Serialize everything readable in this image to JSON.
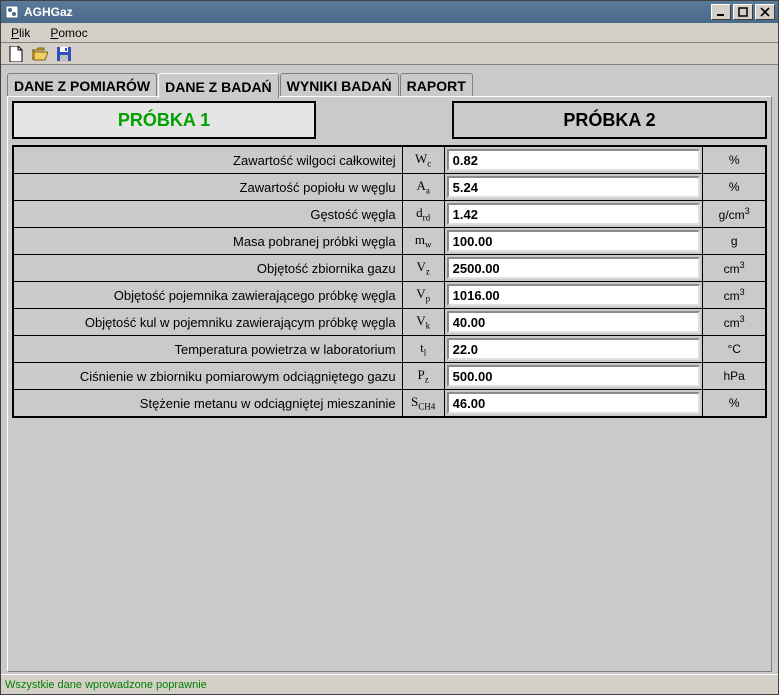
{
  "title": "AGHGaz",
  "menu": {
    "file": "Plik",
    "help": "Pomoc"
  },
  "tabs": {
    "t1": "DANE Z POMIARÓW",
    "t2": "DANE Z BADAŃ",
    "t3": "WYNIKI BADAŃ",
    "t4": "RAPORT"
  },
  "samples": {
    "s1": "PRÓBKA 1",
    "s2": "PRÓBKA 2"
  },
  "rows": [
    {
      "label": "Zawartość wilgoci całkowitej",
      "sym": "W<sub>c</sub>",
      "value": "0.82",
      "unit": "%"
    },
    {
      "label": "Zawartość popiołu w węglu",
      "sym": "A<sub>a</sub>",
      "value": "5.24",
      "unit": "%"
    },
    {
      "label": "Gęstość węgla",
      "sym": "d<sub>rd</sub>",
      "value": "1.42",
      "unit": "g/cm<sup>3</sup>"
    },
    {
      "label": "Masa pobranej próbki węgla",
      "sym": "m<sub>w</sub>",
      "value": "100.00",
      "unit": "g"
    },
    {
      "label": "Objętość zbiornika gazu",
      "sym": "V<sub>z</sub>",
      "value": "2500.00",
      "unit": "cm<sup>3</sup>"
    },
    {
      "label": "Objętość pojemnika zawierającego próbkę węgla",
      "sym": "V<sub>p</sub>",
      "value": "1016.00",
      "unit": "cm<sup>3</sup>"
    },
    {
      "label": "Objętość kul w pojemniku zawierającym próbkę węgla",
      "sym": "V<sub>k</sub>",
      "value": "40.00",
      "unit": "cm<sup>3</sup>"
    },
    {
      "label": "Temperatura powietrza w laboratorium",
      "sym": "t<sub>l</sub>",
      "value": "22.0",
      "unit": "°C"
    },
    {
      "label": "Ciśnienie w zbiorniku pomiarowym odciągniętego gazu",
      "sym": "P<sub>z</sub>",
      "value": "500.00",
      "unit": "hPa"
    },
    {
      "label": "Stężenie metanu w odciągniętej mieszaninie",
      "sym": "S<sub>CH4</sub>",
      "value": "46.00",
      "unit": "%"
    }
  ],
  "status": "Wszystkie dane wprowadzone poprawnie"
}
